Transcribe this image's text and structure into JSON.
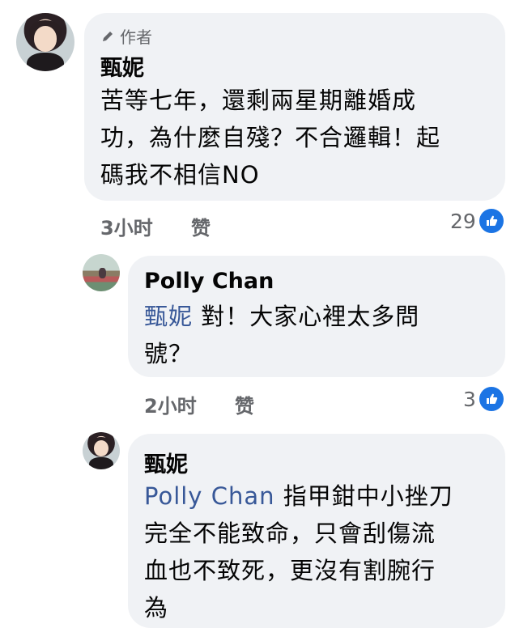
{
  "comments": [
    {
      "badge": "作者",
      "name": "甄妮",
      "lines": [
        "苦等七年，還剩兩星期離婚成",
        "功，為什麼自殘？不合邏輯！起",
        "碼我不相信NO"
      ],
      "time": "3小时",
      "like_label": "赞",
      "likes": "29"
    },
    {
      "name": "Polly Chan",
      "mention": "甄妮",
      "line1_rest": "對！大家心裡太多問",
      "line2": "號？",
      "time": "2小时",
      "like_label": "赞",
      "likes": "3"
    },
    {
      "name": "甄妮",
      "mention": "Polly Chan",
      "line1_rest": "指甲鉗中小挫刀",
      "line2": "完全不能致命，只會刮傷流",
      "line3": "血也不致死，更沒有割腕行",
      "line4": "為"
    }
  ]
}
